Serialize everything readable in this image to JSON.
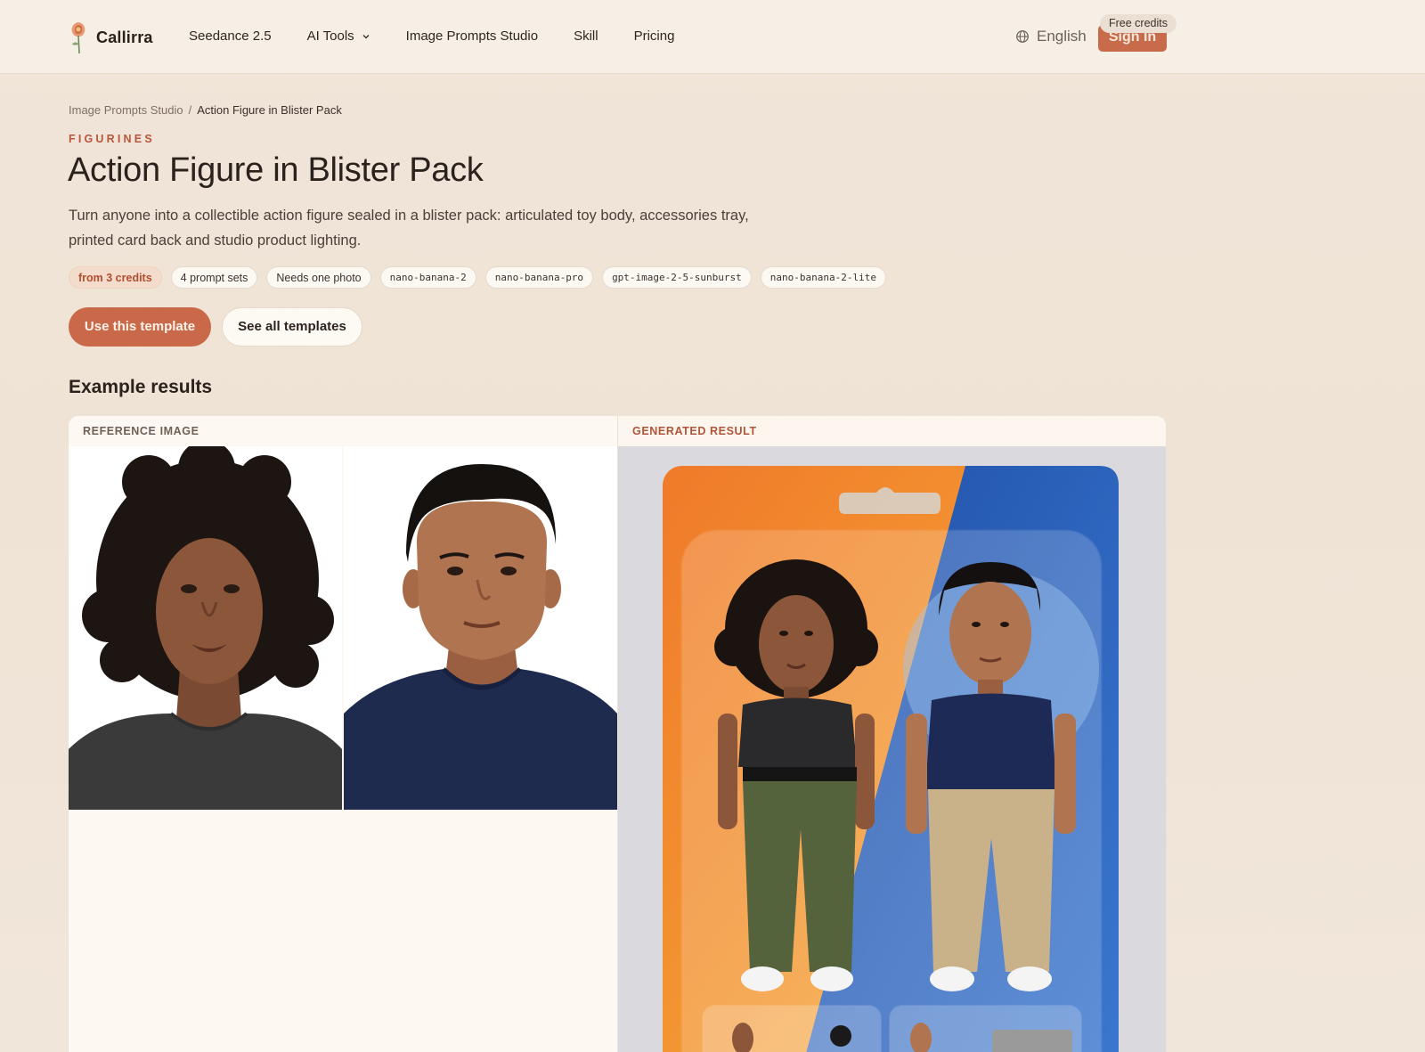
{
  "header": {
    "brand": "Callirra",
    "nav": [
      "Seedance 2.5",
      "AI Tools",
      "Image Prompts Studio",
      "Skill",
      "Pricing"
    ],
    "language": "English",
    "free_badge": "Free credits",
    "sign_in": "Sign In"
  },
  "breadcrumb": {
    "parent": "Image Prompts Studio",
    "separator": "/",
    "current": "Action Figure in Blister Pack"
  },
  "kicker": "FIGURINES",
  "title": "Action Figure in Blister Pack",
  "description": "Turn anyone into a collectible action figure sealed in a blister pack: articulated toy body, accessories tray, printed card back and studio product lighting.",
  "chips": {
    "credits": "from 3 credits",
    "prompt_sets": "4 prompt sets",
    "photo": "Needs one photo",
    "models": [
      "nano-banana-2",
      "nano-banana-pro",
      "gpt-image-2-5-sunburst",
      "nano-banana-2-lite"
    ]
  },
  "actions": {
    "primary": "Use this template",
    "secondary": "See all templates"
  },
  "examples": {
    "title": "Example results",
    "reference_label": "REFERENCE IMAGE",
    "generated_label": "GENERATED RESULT"
  },
  "colors": {
    "accent": "#c9694a",
    "kicker": "#b9553a",
    "background": "#f1e5d9"
  }
}
